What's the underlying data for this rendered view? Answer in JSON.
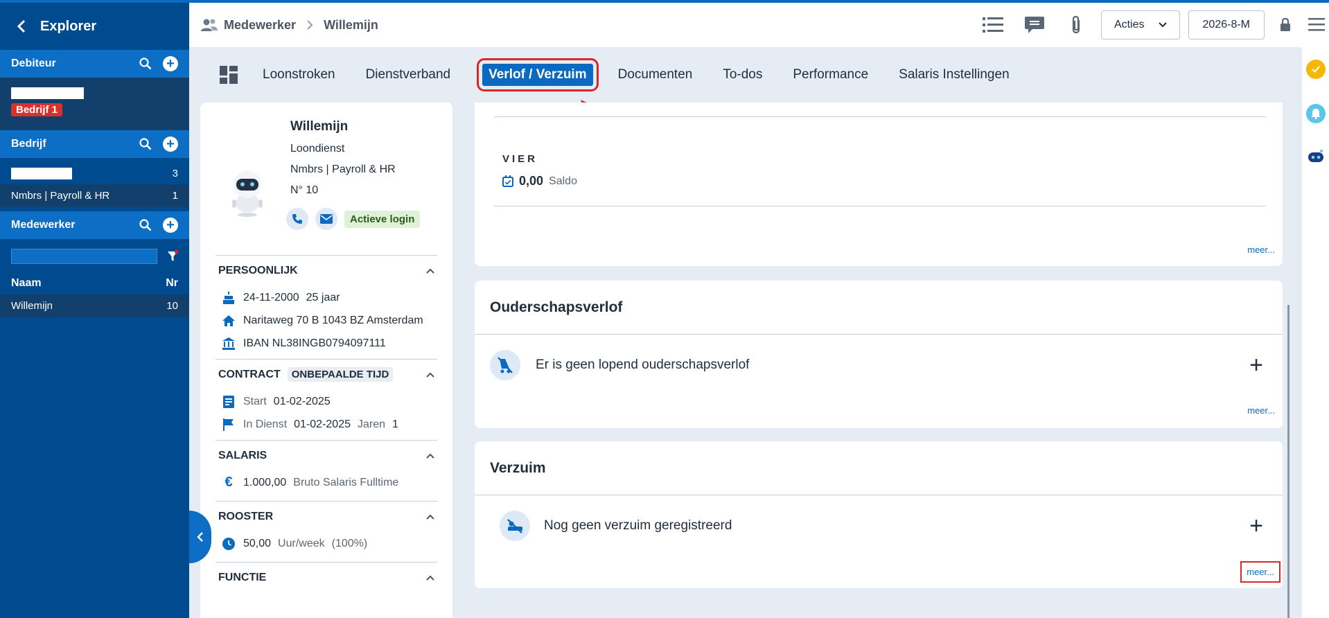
{
  "sidebar": {
    "title": "Explorer",
    "debiteur": {
      "label": "Debiteur",
      "badge": "Bedrijf 1"
    },
    "bedrijf": {
      "label": "Bedrijf",
      "rows": [
        {
          "name": "",
          "nr": "3"
        },
        {
          "name": "Nmbrs | Payroll & HR",
          "nr": "1"
        }
      ]
    },
    "medewerker": {
      "label": "Medewerker",
      "col_name": "Naam",
      "col_nr": "Nr",
      "rows": [
        {
          "name": "Willemijn",
          "nr": "10"
        }
      ]
    }
  },
  "breadcrumb": {
    "section": "Medewerker",
    "current": "Willemijn"
  },
  "toolbar": {
    "acties": "Acties",
    "period": "2026-8-M"
  },
  "tabs": [
    "Loonstroken",
    "Dienstverband",
    "Verlof / Verzuim",
    "Documenten",
    "To-dos",
    "Performance",
    "Salaris Instellingen"
  ],
  "profile": {
    "name": "Willemijn",
    "role": "Loondienst",
    "company": "Nmbrs | Payroll & HR",
    "number": "N° 10",
    "login_badge": "Actieve login",
    "persoonlijk": {
      "title": "PERSOONLIJK",
      "birthdate": "24-11-2000",
      "age": "25 jaar",
      "address": "Naritaweg 70 B 1043 BZ Amsterdam",
      "iban": "IBAN NL38INGB0794097111"
    },
    "contract": {
      "title": "CONTRACT",
      "type": "ONBEPAALDE TIJD",
      "start_label": "Start",
      "start": "01-02-2025",
      "indienst_label": "In Dienst",
      "indienst": "01-02-2025",
      "jaren_label": "Jaren",
      "jaren": "1"
    },
    "salaris": {
      "title": "SALARIS",
      "amount": "1.000,00",
      "label": "Bruto Salaris Fulltime"
    },
    "rooster": {
      "title": "ROOSTER",
      "hours": "50,00",
      "unit": "Uur/week",
      "pct": "(100%)"
    },
    "functie": {
      "title": "FUNCTIE"
    }
  },
  "vier": {
    "label": "VIER",
    "value": "0,00",
    "unit": "Saldo",
    "more": "meer..."
  },
  "ouderschap": {
    "title": "Ouderschapsverlof",
    "message": "Er is geen lopend ouderschapsverlof",
    "add": "+",
    "more": "meer..."
  },
  "verzuim": {
    "title": "Verzuim",
    "message": "Nog geen verzuim geregistreerd",
    "add": "+",
    "more": "meer..."
  },
  "colors": {
    "primary": "#0a6ac0",
    "sidebar": "#004a8f",
    "annotation": "#e02424"
  }
}
